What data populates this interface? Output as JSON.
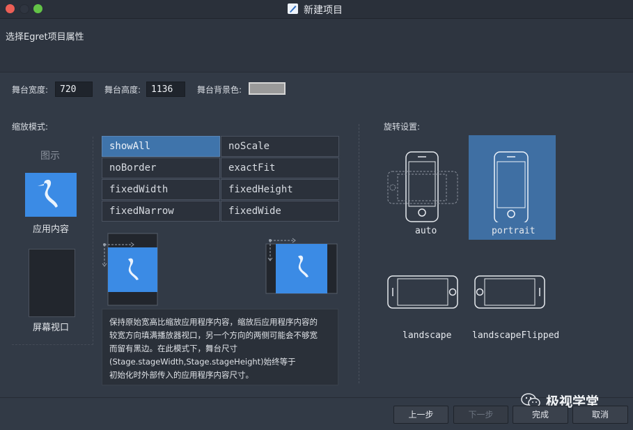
{
  "window": {
    "title": "新建项目"
  },
  "header": {
    "text": "选择Egret项目属性"
  },
  "stage": {
    "width_label": "舞台宽度:",
    "width_value": "720",
    "height_label": "舞台高度:",
    "height_value": "1136",
    "bg_label": "舞台背景色:",
    "bg_color": "#9a9a9a"
  },
  "scale": {
    "section_label": "缩放模式:",
    "legend_title": "图示",
    "app_content_label": "应用内容",
    "screen_viewport_label": "屏幕视口",
    "modes": [
      [
        "showAll",
        "noScale"
      ],
      [
        "noBorder",
        "exactFit"
      ],
      [
        "fixedWidth",
        "fixedHeight"
      ],
      [
        "fixedNarrow",
        "fixedWide"
      ]
    ],
    "selected": "showAll",
    "description": [
      "保持原始宽高比缩放应用程序内容，缩放后应用程序内容的",
      "较宽方向填满播放器视口，另一个方向的两侧可能会不够宽",
      "而留有黑边。在此模式下，舞台尺寸",
      "(Stage.stageWidth,Stage.stageHeight)始终等于",
      "初始化时外部传入的应用程序内容尺寸。"
    ]
  },
  "rotation": {
    "section_label": "旋转设置:",
    "options": [
      "auto",
      "portrait",
      "landscape",
      "landscapeFlipped"
    ],
    "selected": "portrait"
  },
  "buttons": {
    "prev": "上一步",
    "next": "下一步",
    "finish": "完成",
    "cancel": "取消"
  },
  "watermark": {
    "text": "极视学堂"
  },
  "colors": {
    "accent": "#3f74ab",
    "preview_blue": "#3b8be5",
    "background": "#323a46"
  }
}
